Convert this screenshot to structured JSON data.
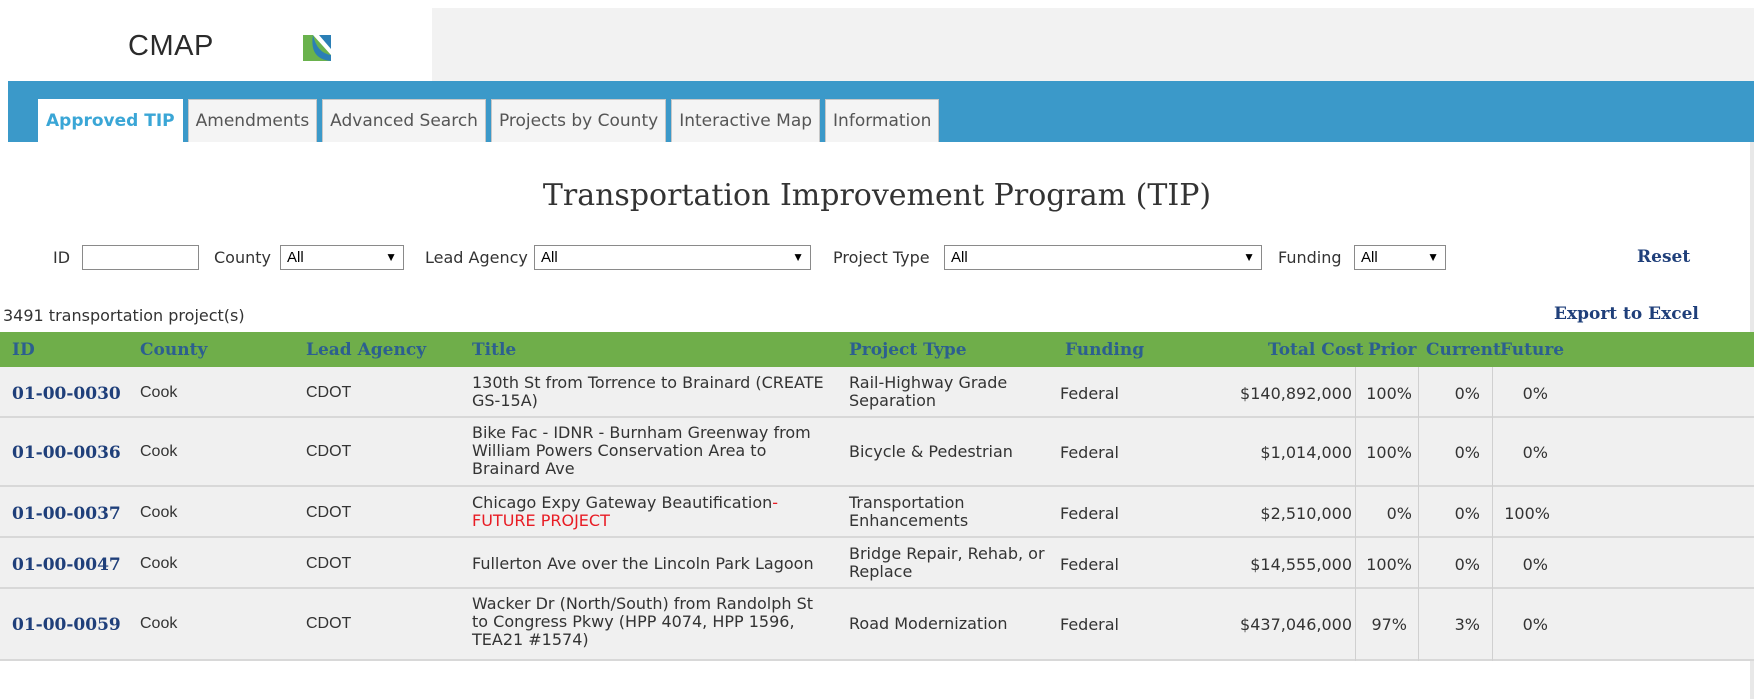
{
  "header": {
    "logo_text": "CMAP",
    "brand_colors": {
      "green": "#6ab24d",
      "blue": "#2b7fb6",
      "nav_blue": "#3b99c9",
      "table_header_green": "#6fae4a"
    }
  },
  "nav": {
    "tabs": [
      {
        "label": "Approved TIP",
        "active": true
      },
      {
        "label": "Amendments",
        "active": false
      },
      {
        "label": "Advanced Search",
        "active": false
      },
      {
        "label": "Projects by County",
        "active": false
      },
      {
        "label": "Interactive Map",
        "active": false
      },
      {
        "label": "Information",
        "active": false
      }
    ]
  },
  "page_title": "Transportation Improvement Program (TIP)",
  "filters": {
    "id_label": "ID",
    "id_value": "",
    "county_label": "County",
    "county_value": "All",
    "lead_agency_label": "Lead Agency",
    "lead_agency_value": "All",
    "project_type_label": "Project Type",
    "project_type_value": "All",
    "funding_label": "Funding",
    "funding_value": "All",
    "reset_label": "Reset"
  },
  "results": {
    "count_text": "3491 transportation project(s)",
    "export_label": "Export to Excel"
  },
  "table": {
    "columns": [
      "ID",
      "County",
      "Lead Agency",
      "Title",
      "Project Type",
      "Funding",
      "Total Cost",
      "Prior",
      "Current",
      "Future"
    ],
    "rows": [
      {
        "id": "01-00-0030",
        "county": "Cook",
        "lead_agency": "CDOT",
        "title_lines": [
          "130th St from Torrence to Brainard (CREATE",
          "GS-15A)"
        ],
        "title_suffix": "",
        "project_type_lines": [
          "Rail-Highway Grade",
          "Separation"
        ],
        "funding": "Federal",
        "total_cost": "$140,892,000",
        "prior": "100%",
        "current": "0%",
        "future": "0%"
      },
      {
        "id": "01-00-0036",
        "county": "Cook",
        "lead_agency": "CDOT",
        "title_lines": [
          "Bike Fac - IDNR - Burnham Greenway from",
          "William Powers Conservation Area to",
          "Brainard Ave"
        ],
        "title_suffix": "",
        "project_type_lines": [
          "Bicycle & Pedestrian"
        ],
        "funding": "Federal",
        "total_cost": "$1,014,000",
        "prior": "100%",
        "current": "0%",
        "future": "0%"
      },
      {
        "id": "01-00-0037",
        "county": "Cook",
        "lead_agency": "CDOT",
        "title_lines": [
          "Chicago Expy Gateway Beautification"
        ],
        "title_suffix": "-",
        "title_red": "FUTURE PROJECT",
        "project_type_lines": [
          "Transportation",
          "Enhancements"
        ],
        "funding": "Federal",
        "total_cost": "$2,510,000",
        "prior": "0%",
        "current": "0%",
        "future": "100%"
      },
      {
        "id": "01-00-0047",
        "county": "Cook",
        "lead_agency": "CDOT",
        "title_lines": [
          "Fullerton Ave over the Lincoln Park Lagoon"
        ],
        "title_suffix": "",
        "project_type_lines": [
          "Bridge Repair, Rehab, or",
          "Replace"
        ],
        "funding": "Federal",
        "total_cost": "$14,555,000",
        "prior": "100%",
        "current": "0%",
        "future": "0%"
      },
      {
        "id": "01-00-0059",
        "county": "Cook",
        "lead_agency": "CDOT",
        "title_lines": [
          "Wacker Dr (North/South) from Randolph St",
          "to Congress Pkwy (HPP 4074, HPP 1596,",
          "TEA21 #1574)"
        ],
        "title_suffix": "",
        "project_type_lines": [
          "Road Modernization"
        ],
        "funding": "Federal",
        "total_cost": "$437,046,000",
        "prior": "97%",
        "current": "3%",
        "future": "0%"
      }
    ]
  }
}
